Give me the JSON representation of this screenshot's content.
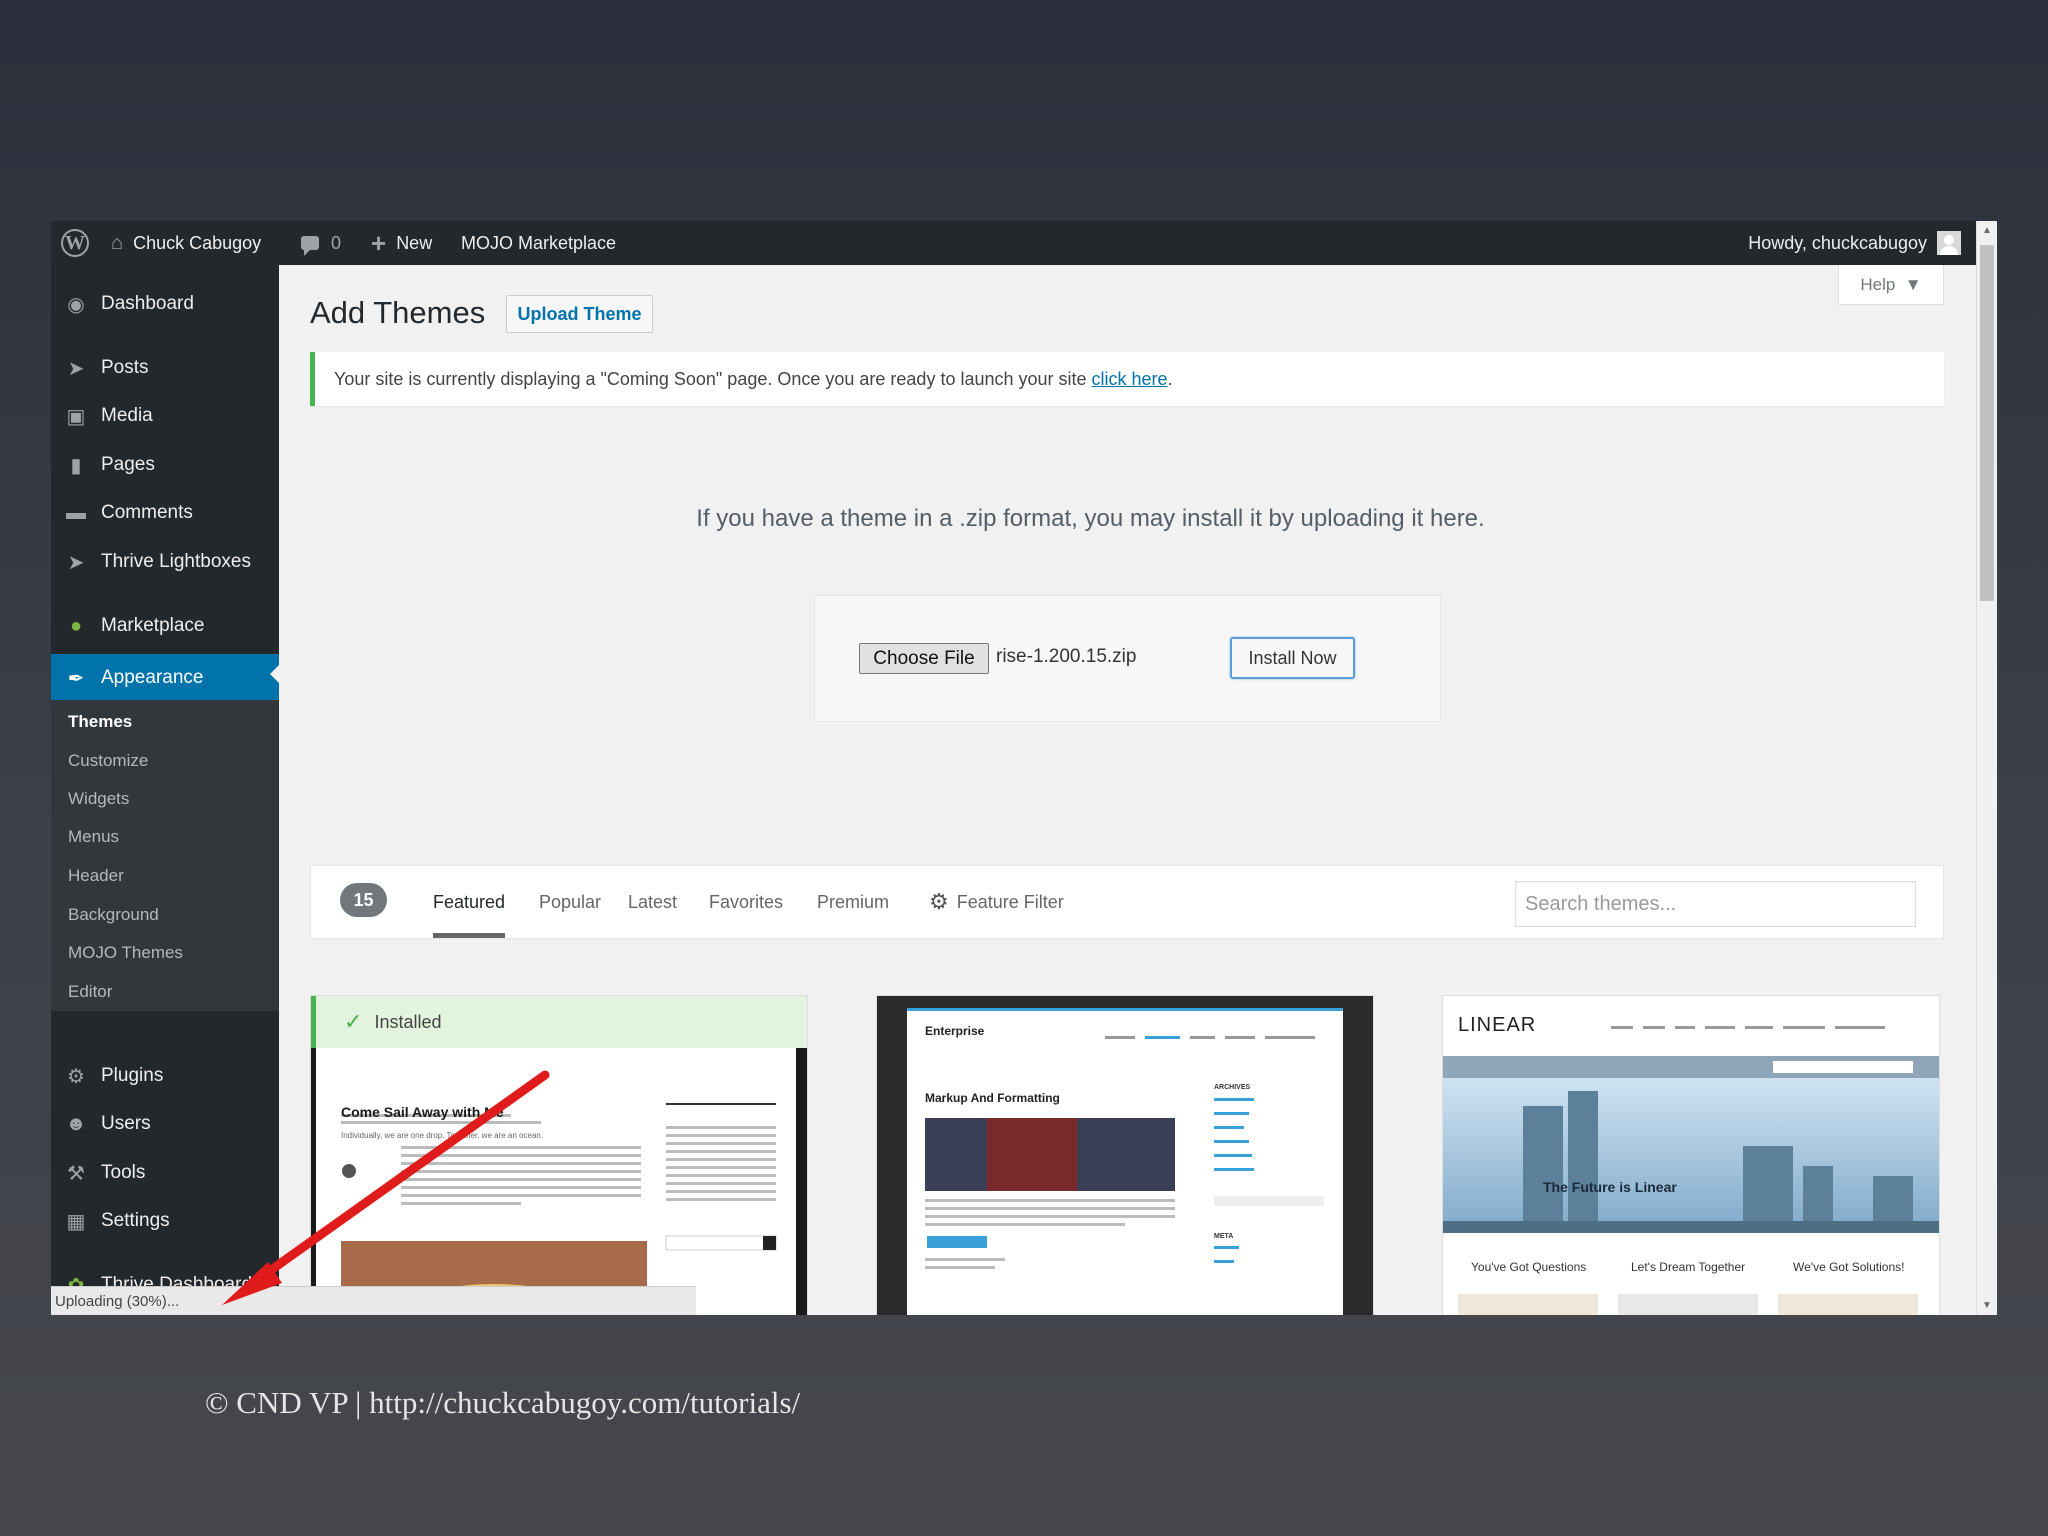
{
  "admin_bar": {
    "site_name": "Chuck Cabugoy",
    "comments_count": "0",
    "new_label": "New",
    "marketplace_label": "MOJO Marketplace",
    "greeting": "Howdy, chuckcabugoy"
  },
  "sidebar": {
    "items": [
      {
        "label": "Dashboard",
        "icon": "dashboard-icon"
      },
      {
        "label": "Posts",
        "icon": "pin-icon"
      },
      {
        "label": "Media",
        "icon": "media-icon"
      },
      {
        "label": "Pages",
        "icon": "pages-icon"
      },
      {
        "label": "Comments",
        "icon": "comment-icon"
      },
      {
        "label": "Thrive Lightboxes",
        "icon": "pin-icon"
      },
      {
        "label": "Marketplace",
        "icon": "marketplace-icon"
      },
      {
        "label": "Appearance",
        "icon": "brush-icon"
      },
      {
        "label": "Plugins",
        "icon": "plug-icon"
      },
      {
        "label": "Users",
        "icon": "user-icon"
      },
      {
        "label": "Tools",
        "icon": "wrench-icon"
      },
      {
        "label": "Settings",
        "icon": "settings-icon"
      },
      {
        "label": "Thrive Dashboard",
        "icon": "leaf-icon"
      }
    ],
    "submenu": [
      "Themes",
      "Customize",
      "Widgets",
      "Menus",
      "Header",
      "Background",
      "MOJO Themes",
      "Editor"
    ]
  },
  "status_text": "Uploading (30%)...",
  "main": {
    "help_label": "Help",
    "title": "Add Themes",
    "upload_button": "Upload Theme",
    "notice_text": "Your site is currently displaying a \"Coming Soon\" page. Once you are ready to launch your site ",
    "notice_link": "click here",
    "notice_end": ".",
    "upload_description": "If you have a theme in a .zip format, you may install it by uploading it here.",
    "choose_file_label": "Choose File",
    "file_name": "rise-1.200.15.zip",
    "install_button": "Install Now"
  },
  "filter": {
    "count": "15",
    "tabs": [
      "Featured",
      "Popular",
      "Latest",
      "Favorites",
      "Premium"
    ],
    "feature_filter": "Feature Filter",
    "search_placeholder": "Search themes..."
  },
  "themes": {
    "installed_label": "Installed",
    "card1": {
      "post_title": "Come Sail Away with Me",
      "post_sub": "Individually, we are one drop. Together, we are an ocean."
    },
    "card2": {
      "site": "Enterprise",
      "post_title": "Markup And Formatting",
      "widget_archives": "ARCHIVES",
      "widget_meta": "META"
    },
    "card3": {
      "logo": "LINEAR",
      "hero": "The Future is Linear",
      "cols": [
        "You've Got Questions",
        "Let's Dream Together",
        "We've Got Solutions!"
      ]
    }
  },
  "colors": {
    "admin_bar": "#23282d",
    "accent": "#0073aa",
    "success": "#46b450",
    "annotation_arrow": "#e01b1b"
  },
  "footer_credit": "© CND VP | http://chuckcabugoy.com/tutorials/"
}
